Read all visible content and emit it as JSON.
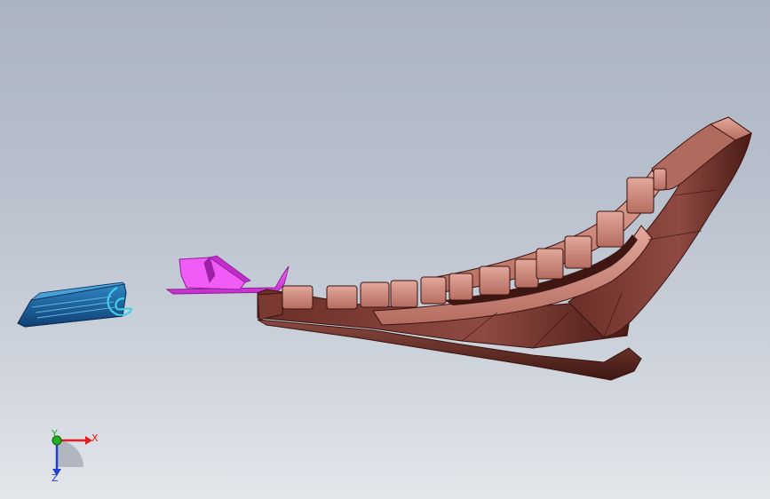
{
  "viewport": {
    "background_top": "#aab3c2",
    "background_bottom": "#e3e6ea"
  },
  "parts": [
    {
      "name": "blue-extrusion",
      "color": "#1d6fa8",
      "accent": "#3fd0e8"
    },
    {
      "name": "magenta-bracket",
      "color": "#e040e6",
      "accent": "#b02ab8"
    },
    {
      "name": "copper-seat-frame",
      "color": "#c88478",
      "accent": "#5a2420"
    }
  ],
  "triad": {
    "x_label": "X",
    "y_label": "Y",
    "z_label": "Z",
    "x_color": "#e02020",
    "y_color": "#20b020",
    "z_color": "#2040d0"
  }
}
